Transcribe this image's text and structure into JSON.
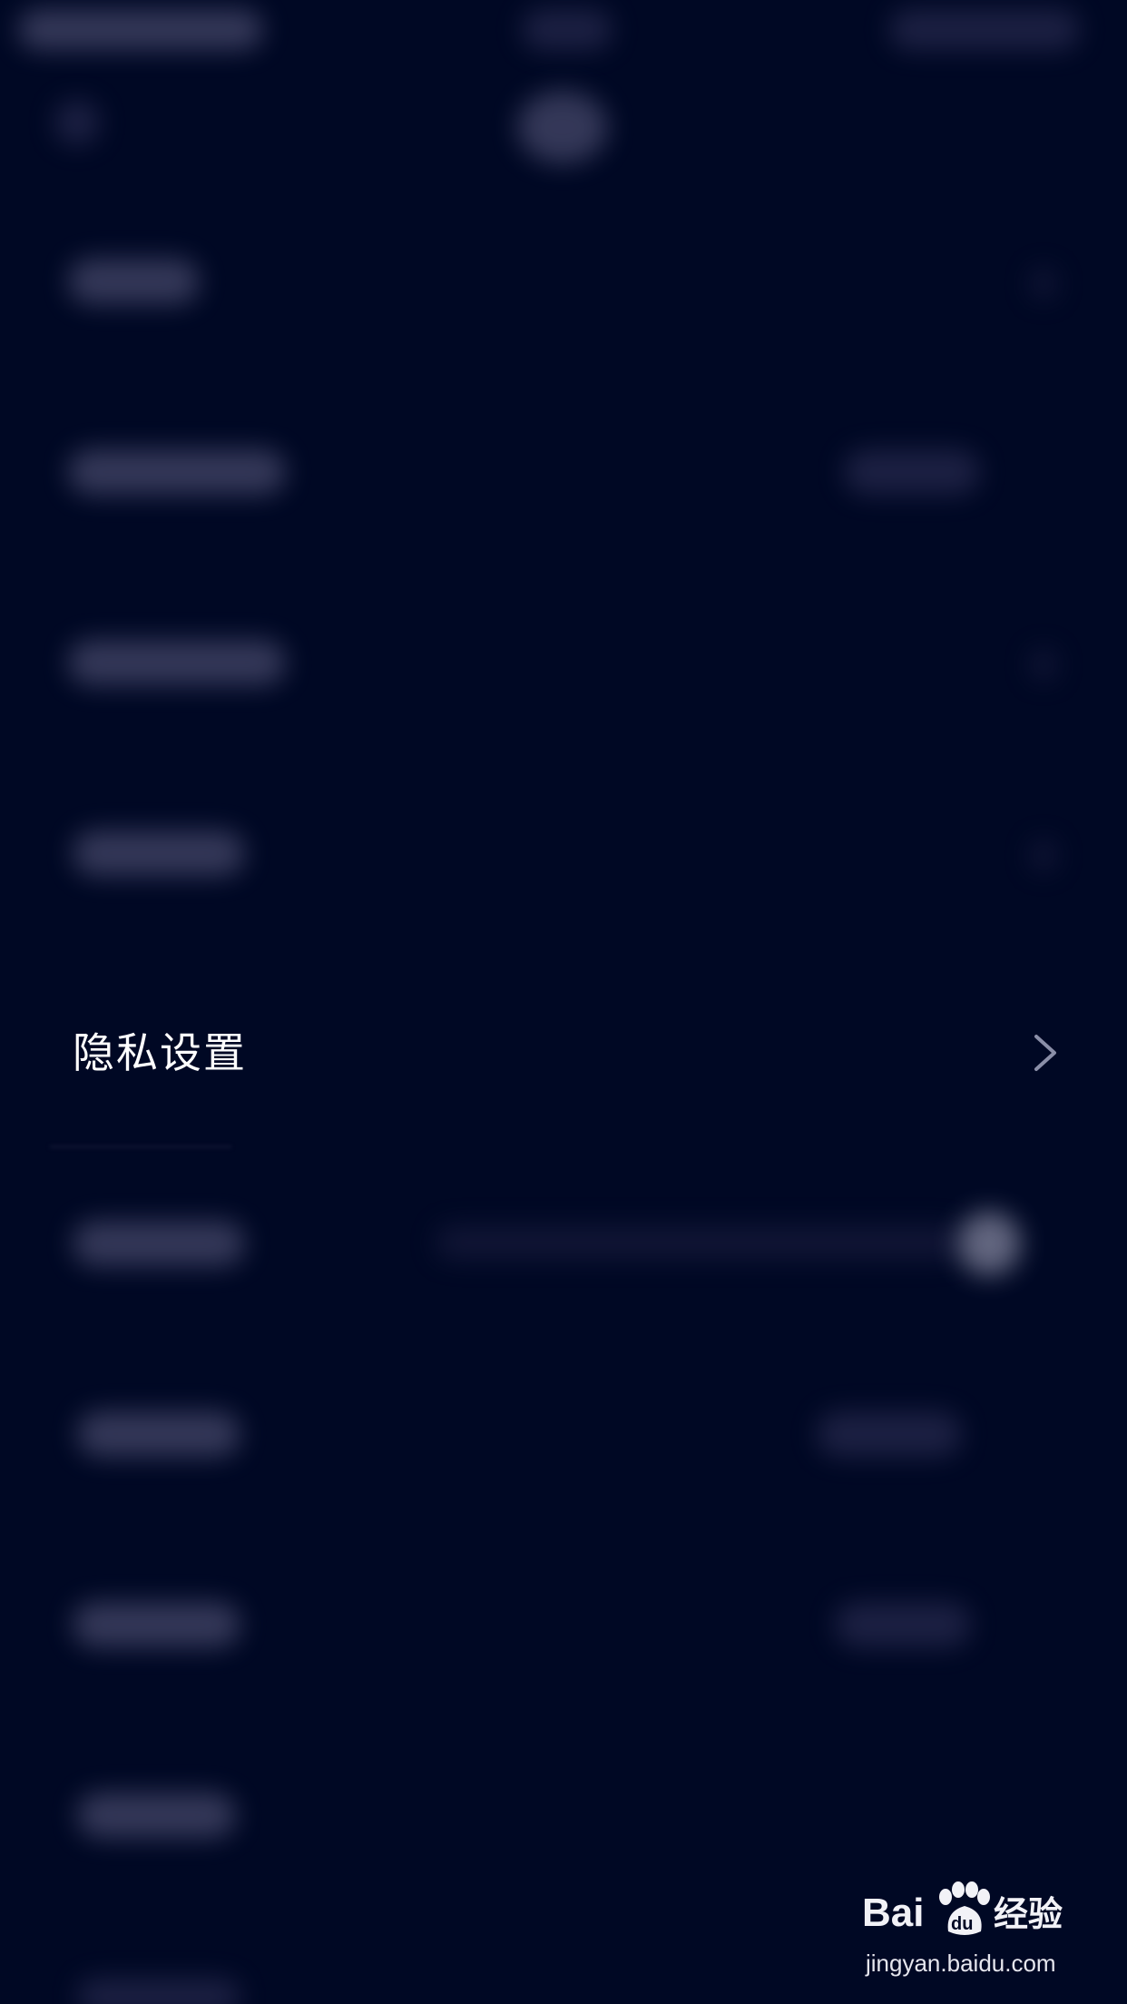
{
  "list": {
    "privacy_settings_label": "隐私设置"
  },
  "icons": {
    "row_chevron": "chevron-right-icon",
    "watermark": "baidu-paw-logo"
  },
  "watermark": {
    "brand_text": "Bai du 经验",
    "url": "jingyan.baidu.com"
  },
  "colors": {
    "background": "#000824",
    "text": "#ffffff",
    "chevron": "#8a8fa8"
  }
}
